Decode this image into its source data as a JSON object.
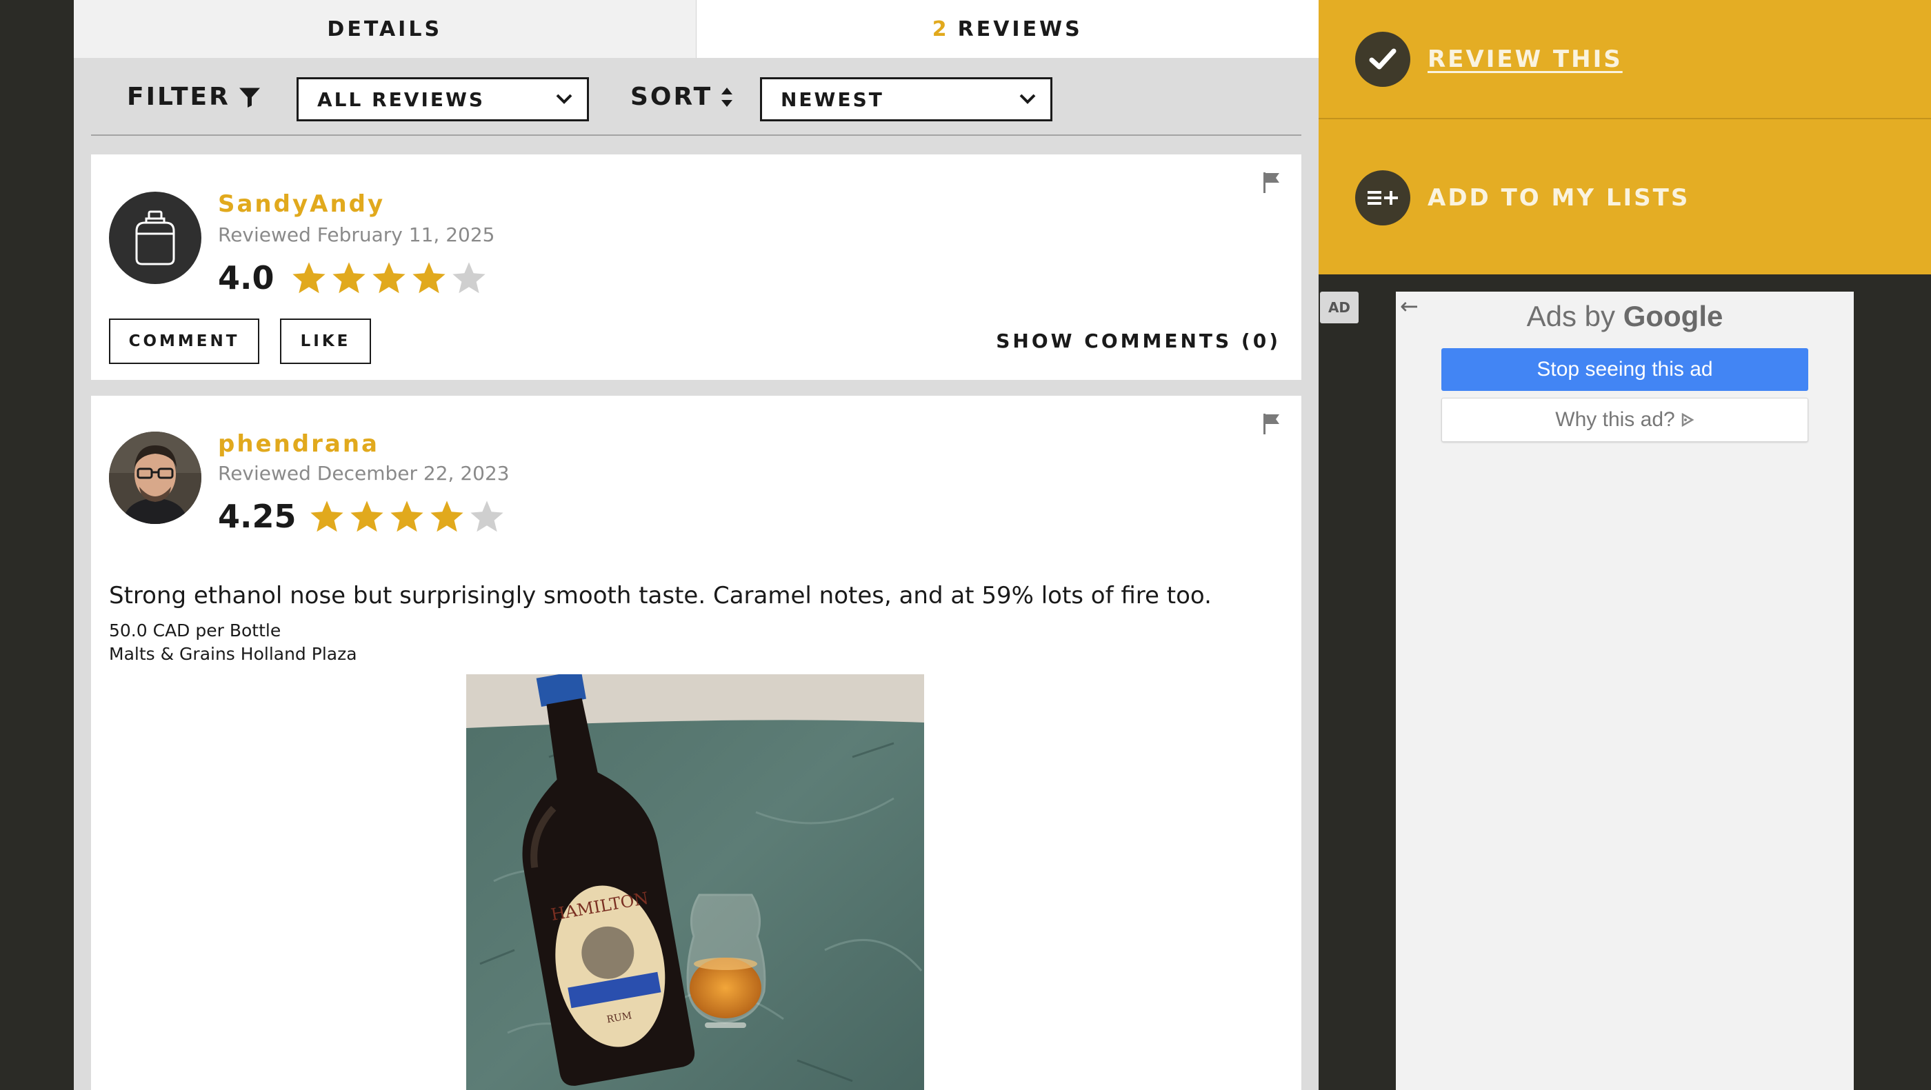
{
  "tabs": {
    "details_label": "DETAILS",
    "reviews_count": "2",
    "reviews_label": "REVIEWS"
  },
  "filterbar": {
    "filter_label": "FILTER",
    "filter_value": "ALL REVIEWS",
    "sort_label": "SORT",
    "sort_value": "NEWEST"
  },
  "reviews": [
    {
      "username": "SandyAndy",
      "date": "Reviewed February 11, 2025",
      "rating": "4.0",
      "stars": 4,
      "comment_label": "COMMENT",
      "like_label": "LIKE",
      "show_comments": "SHOW COMMENTS (0)"
    },
    {
      "username": "phendrana",
      "date": "Reviewed December 22, 2023",
      "rating": "4.25",
      "stars": 4.25,
      "text": "Strong ethanol nose but surprisingly smooth taste. Caramel notes, and at 59% lots of fire too.",
      "price": "50.0 CAD per Bottle",
      "store": "Malts & Grains Holland Plaza"
    }
  ],
  "actions": {
    "review_this": "REVIEW THIS",
    "add_to_lists": "ADD TO MY LISTS"
  },
  "ad": {
    "badge": "AD",
    "ads_by": "Ads by",
    "google": "Google",
    "stop": "Stop seeing this ad",
    "why": "Why this ad?"
  },
  "colors": {
    "accent": "#e1a91d",
    "panel": "#e4ad24",
    "background": "#2b2b26",
    "google_blue": "#4285f4"
  }
}
